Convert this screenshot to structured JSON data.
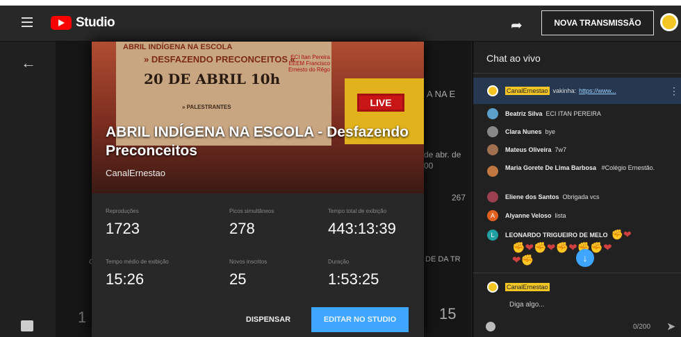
{
  "header": {
    "app_name": "Studio",
    "new_broadcast_label": "NOVA TRANSMISSÃO"
  },
  "modal": {
    "poster_banner": "ABRIL INDÍGENA NA ESCOLA",
    "poster_subtitle": "» DESFAZENDO PRECONCEITOS «",
    "poster_date": "20 DE ABRIL 10h",
    "poster_schools": "ECI Itan Pereira\nEEEM Francisco Ernesto do Rêgo",
    "poster_speakers": "» PALESTRANTES",
    "live_badge": "LIVE",
    "video_title": "ABRIL INDÍGENA NA ESCOLA - Desfazendo Preconceitos",
    "channel": "CanalErnestao",
    "stats": [
      {
        "label": "Reproduções",
        "value": "1723"
      },
      {
        "label": "Picos simultâneos",
        "value": "278"
      },
      {
        "label": "Tempo total de exibição",
        "value": "443:13:39"
      },
      {
        "label": "Tempo médio de exibição",
        "value": "15:26"
      },
      {
        "label": "Novos inscritos",
        "value": "25"
      },
      {
        "label": "Duração",
        "value": "1:53:25"
      }
    ],
    "dismiss_label": "DISPENSAR",
    "edit_label": "EDITAR NO STUDIO"
  },
  "background": {
    "frag1": "A NA E",
    "frag2": "de abr. de",
    "frag3": "00",
    "frag4": "267",
    "frag5": "DE DA TR",
    "frag6": "15",
    "frag7": "CC"
  },
  "chat": {
    "title": "Chat ao vivo",
    "pinned": {
      "badge": "CanalErnestao",
      "text": "vakinha:",
      "link": "https://www..."
    },
    "messages": [
      {
        "name": "Beatriz Silva",
        "text": "ECI ITAN PEREIRA",
        "color": "#5aa0c8"
      },
      {
        "name": "Clara Nunes",
        "text": "bye",
        "color": "#888888"
      },
      {
        "name": "Mateus Oliveira",
        "text": "7w7",
        "color": "#a07050"
      },
      {
        "name": "Maria Gorete De Lima Barbosa",
        "text": "#Colégio Ernestão.",
        "color": "#c07840"
      },
      {
        "name": "Eliene dos Santos",
        "text": "Obrigada vcs",
        "color": "#9a4050"
      },
      {
        "name": "Alyanne Veloso",
        "text": "lista",
        "color": "#e06020",
        "initial": "A"
      },
      {
        "name": "LEONARDO TRIGUEIRO DE MELO",
        "text": "",
        "color": "#20a0a0",
        "initial": "L"
      }
    ],
    "input_badge": "CanalErnestao",
    "input_placeholder": "Diga algo...",
    "char_count": "0/200"
  }
}
